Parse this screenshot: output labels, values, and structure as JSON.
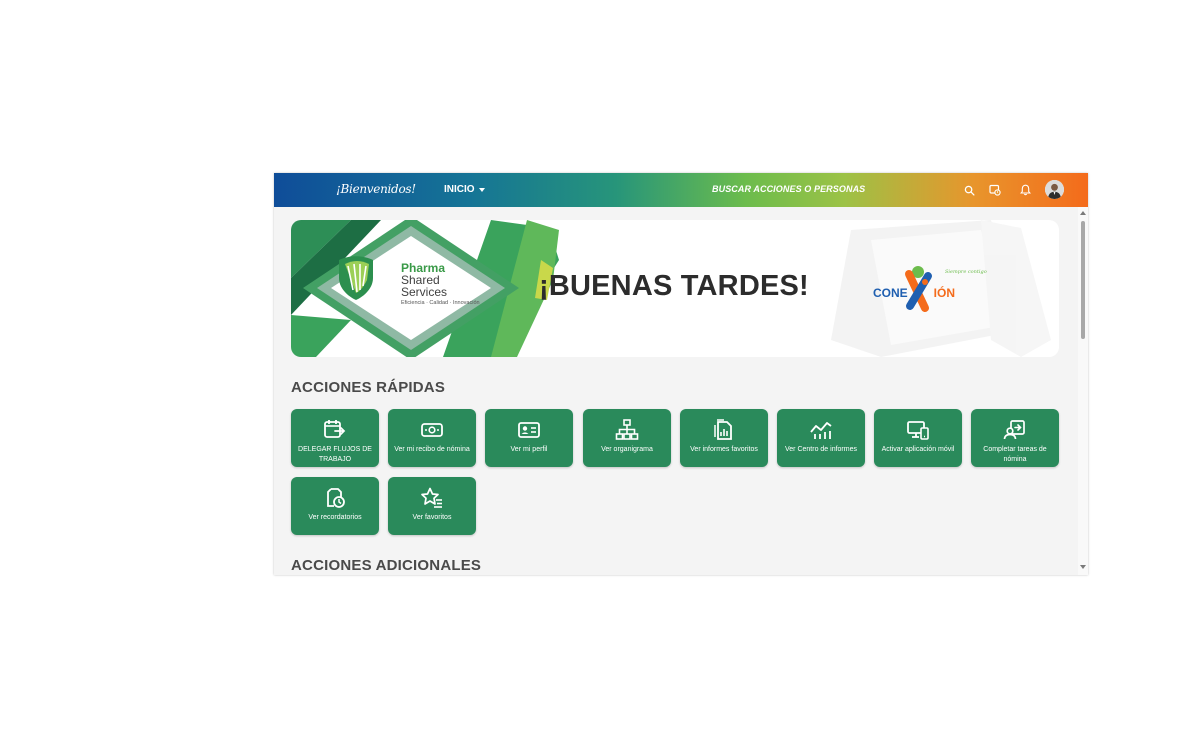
{
  "topbar": {
    "welcome": "¡Bienvenidos!",
    "nav_label": "INICIO",
    "search_label": "BUSCAR ACCIONES O PERSONAS"
  },
  "banner": {
    "greeting": "¡BUENAS TARDES!",
    "brand_line1": "Pharma",
    "brand_line2": "Shared",
    "brand_line3": "Services",
    "brand_tagline": "Eficiencia · Calidad · Innovación",
    "logo_conexion_left": "CONE",
    "logo_conexion_right": "IÓN",
    "logo_slogan": "Siempre contigo"
  },
  "quick_actions": {
    "title": "ACCIONES RÁPIDAS",
    "items": [
      {
        "label": "DELEGAR FLUJOS DE TRABAJO",
        "icon": "calendar-delegate-icon"
      },
      {
        "label": "Ver mi recibo de nómina",
        "icon": "money-icon"
      },
      {
        "label": "Ver mi perfil",
        "icon": "id-card-icon"
      },
      {
        "label": "Ver organigrama",
        "icon": "org-chart-icon"
      },
      {
        "label": "Ver informes favoritos",
        "icon": "report-icon"
      },
      {
        "label": "Ver Centro de informes",
        "icon": "line-chart-icon"
      },
      {
        "label": "Activar aplicación móvil",
        "icon": "devices-icon"
      },
      {
        "label": "Completar tareas de nómina",
        "icon": "user-tasks-icon"
      },
      {
        "label": "Ver recordatorios",
        "icon": "reminder-icon"
      },
      {
        "label": "Ver favoritos",
        "icon": "star-list-icon"
      }
    ]
  },
  "additional_actions": {
    "title": "ACCIONES ADICIONALES"
  },
  "colors": {
    "tile": "#2a8a5b",
    "accent_green": "#3a9a48",
    "accent_orange": "#f46b1b",
    "accent_blue": "#0f4d99"
  }
}
